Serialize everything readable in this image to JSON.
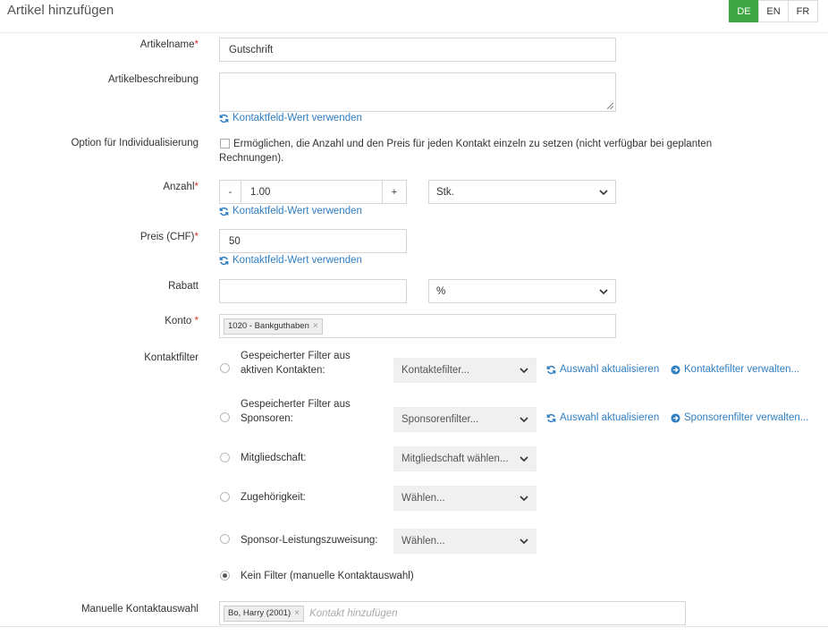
{
  "header": {
    "title": "Artikel hinzufügen"
  },
  "languages": [
    {
      "code": "DE",
      "active": true
    },
    {
      "code": "EN",
      "active": false
    },
    {
      "code": "FR",
      "active": false
    }
  ],
  "form": {
    "artikelname": {
      "label": "Artikelname",
      "value": "Gutschrift"
    },
    "beschreibung": {
      "label": "Artikelbeschreibung",
      "value": ""
    },
    "contact_link": "Kontaktfeld-Wert verwenden",
    "individualisierung": {
      "label": "Option für Individualisierung",
      "text": "Ermöglichen, die Anzahl und den Preis für jeden Kontakt einzeln zu setzen (nicht verfügbar bei geplanten Rechnungen).",
      "checked": false
    },
    "anzahl": {
      "label": "Anzahl",
      "minus": "-",
      "plus": "+",
      "value": "1.00",
      "unit": "Stk."
    },
    "preis": {
      "label": "Preis (CHF)",
      "value": "50"
    },
    "rabatt": {
      "label": "Rabatt",
      "value": "",
      "unit": "%"
    },
    "konto": {
      "label": "Konto",
      "tag": "1020 - Bankguthaben"
    },
    "kontaktfilter": {
      "label": "Kontaktfilter",
      "options": [
        {
          "label_line1": "Gespeicherter Filter aus",
          "label_line2": "aktiven Kontakten:",
          "select": "Kontaktefilter...",
          "refresh": "Auswahl aktualisieren",
          "manage": "Kontaktefilter verwalten..."
        },
        {
          "label_line1": "Gespeicherter Filter aus",
          "label_line2": "Sponsoren:",
          "select": "Sponsorenfilter...",
          "refresh": "Auswahl aktualisieren",
          "manage": "Sponsorenfilter verwalten..."
        },
        {
          "label": "Mitgliedschaft:",
          "select": "Mitgliedschaft wählen..."
        },
        {
          "label": "Zugehörigkeit:",
          "select": "Wählen..."
        },
        {
          "label": "Sponsor-Leistungszuweisung:",
          "select": "Wählen..."
        },
        {
          "label": "Kein Filter (manuelle Kontaktauswahl)",
          "checked": true
        }
      ]
    },
    "manuell": {
      "label": "Manuelle Kontaktauswahl",
      "tag": "Bo, Harry (2001)",
      "placeholder": "Kontakt hinzufügen"
    }
  },
  "colors": {
    "accent_green": "#3fa845",
    "link_blue": "#2f7ec2",
    "required_red": "#d9312b"
  }
}
